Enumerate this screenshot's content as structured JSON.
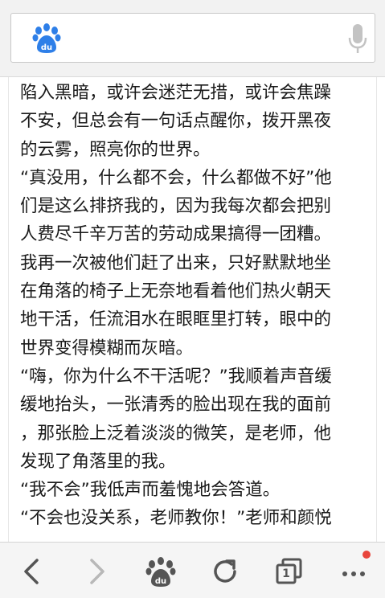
{
  "search": {
    "logo_icon": "baidu-paw-icon",
    "mic_icon": "microphone-icon",
    "logo_color": "#2e7fe8"
  },
  "article": {
    "lines": [
      "陷入黑暗，或许会迷茫无措，或许会焦躁",
      "不安，但总会有一句话点醒你，拨开黑夜",
      "的云雾，照亮你的世界。",
      "“真没用，什么都不会，什么都做不好”他",
      "们是这么排挤我的，因为我每次都会把别",
      "人费尽千辛万苦的劳动成果搞得一团糟。",
      "我再一次被他们赶了出来，只好默默地坐",
      "在角落的椅子上无奈地看着他们热火朝天",
      "地干活，任流泪水在眼眶里打转，眼中的",
      "世界变得模糊而灰暗。",
      "“嗨，你为什么不干活呢？”我顺着声音缓",
      "缓地抬头，一张清秀的脸出现在我的面前",
      "，那张脸上泛着淡淡的微笑，是老师，他",
      "发现了角落里的我。",
      "“我不会”我低声而羞愧地会答道。",
      "“不会也没关系，老师教你！”老师和颜悦"
    ]
  },
  "toolbar": {
    "back_icon": "back-arrow-icon",
    "forward_icon": "forward-arrow-icon",
    "home_icon": "baidu-paw-icon",
    "refresh_icon": "refresh-icon",
    "tabs_icon": "tabs-icon",
    "tabs_count": "1",
    "menu_icon": "more-dots-icon",
    "notification_color": "#e8453c"
  }
}
